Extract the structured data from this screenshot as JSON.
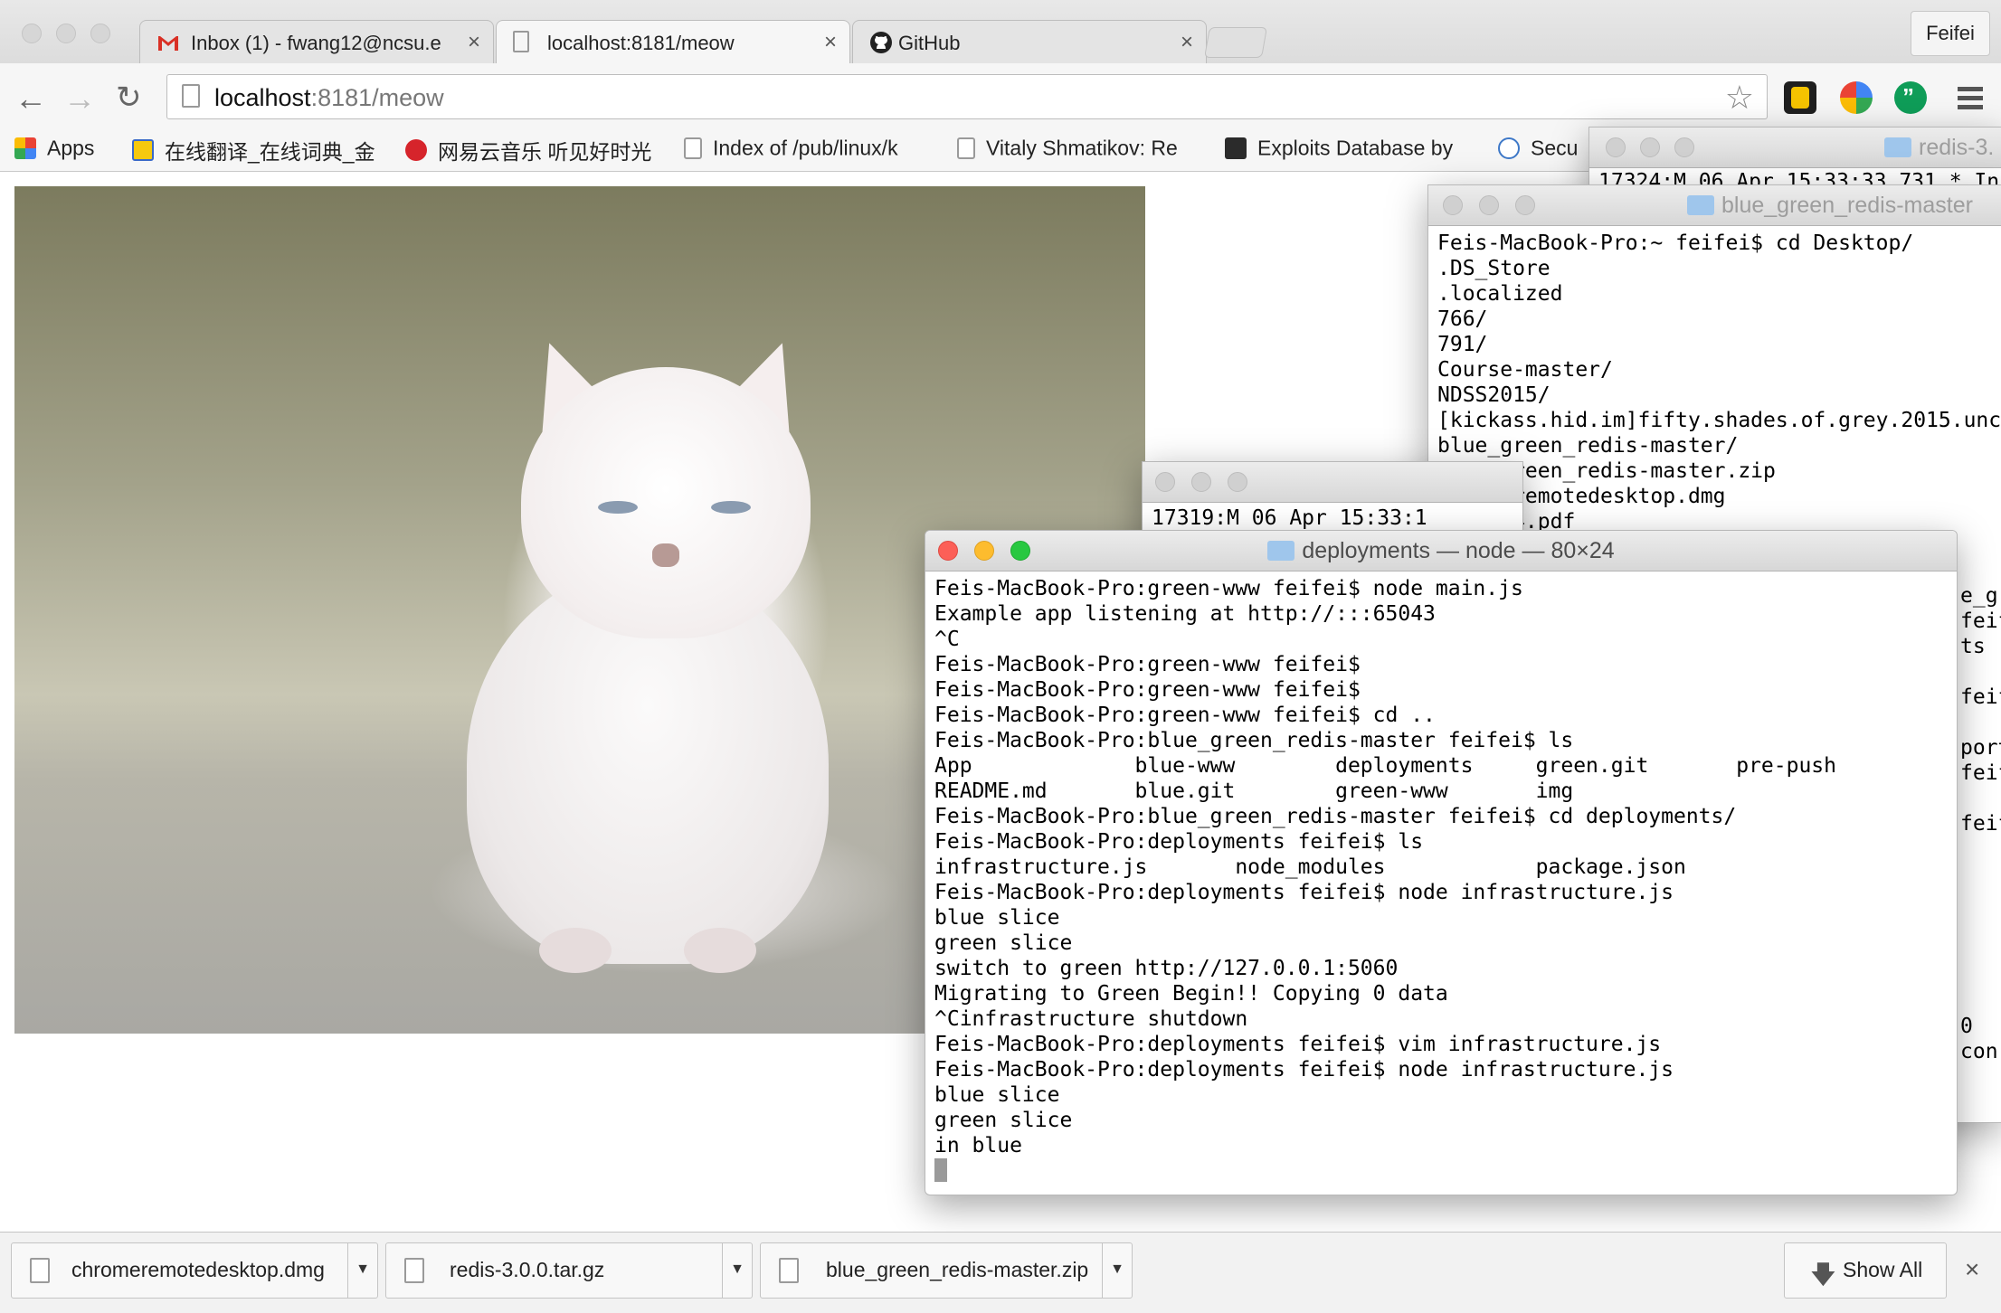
{
  "browser": {
    "tabs": [
      {
        "label": "Inbox (1) - fwang12@ncsu.e",
        "icon": "gmail-icon",
        "close": "×"
      },
      {
        "label": "localhost:8181/meow",
        "icon": "page-icon",
        "close": "×"
      },
      {
        "label": "GitHub",
        "icon": "github-icon",
        "close": "×"
      }
    ],
    "profile_name": "Feifei",
    "url_host": "localhost",
    "url_rest": ":8181/meow",
    "bookmarks": [
      {
        "label": "Apps",
        "icon": "apps-grid-icon"
      },
      {
        "label": "在线翻译_在线词典_金",
        "icon": "dictionary-icon"
      },
      {
        "label": "网易云音乐 听见好时光",
        "icon": "netease-music-icon"
      },
      {
        "label": "Index of /pub/linux/k",
        "icon": "page-icon"
      },
      {
        "label": "Vitaly Shmatikov: Re",
        "icon": "page-icon"
      },
      {
        "label": "Exploits Database by",
        "icon": "exploit-db-icon"
      },
      {
        "label": "Secu",
        "icon": "security-icon"
      }
    ],
    "accent": "#4285f4"
  },
  "terminals": {
    "back": {
      "title": "redis-3.",
      "line": "17324:M 06 Apr 15:33:33.731 * In"
    },
    "desktop": {
      "title": "blue_green_redis-master",
      "lines": [
        "Feis-MacBook-Pro:~ feifei$ cd Desktop/",
        ".DS_Store",
        ".localized",
        "766/",
        "791/",
        "Course-master/",
        "NDSS2015/",
        "[kickass.hid.im]fifty.shades.of.grey.2015.unc",
        "blue_green_redis-master/",
        "blue_green_redis-master.zip",
        "chromeremotedesktop.dmg",
        "micro14.pdf"
      ],
      "right_fragments": [
        "e_gr",
        "feif",
        "ts",
        "",
        "feif",
        "",
        "port",
        "feif",
        "",
        "feif",
        "",
        "",
        "",
        "",
        "",
        "",
        "",
        "0",
        "con"
      ]
    },
    "redis": {
      "line": "17319:M 06 Apr 15:33:1"
    },
    "main": {
      "title": "deployments — node — 80×24",
      "lines": [
        "Feis-MacBook-Pro:green-www feifei$ node main.js",
        "Example app listening at http://:::65043",
        "^C",
        "Feis-MacBook-Pro:green-www feifei$",
        "Feis-MacBook-Pro:green-www feifei$",
        "Feis-MacBook-Pro:green-www feifei$ cd ..",
        "Feis-MacBook-Pro:blue_green_redis-master feifei$ ls",
        "App             blue-www        deployments     green.git       pre-push",
        "README.md       blue.git        green-www       img",
        "Feis-MacBook-Pro:blue_green_redis-master feifei$ cd deployments/",
        "Feis-MacBook-Pro:deployments feifei$ ls",
        "infrastructure.js       node_modules            package.json",
        "Feis-MacBook-Pro:deployments feifei$ node infrastructure.js",
        "blue slice",
        "green slice",
        "switch to green http://127.0.0.1:5060",
        "Migrating to Green Begin!! Copying 0 data",
        "^Cinfrastructure shutdown",
        "Feis-MacBook-Pro:deployments feifei$ vim infrastructure.js",
        "Feis-MacBook-Pro:deployments feifei$ node infrastructure.js",
        "blue slice",
        "green slice",
        "in blue"
      ]
    }
  },
  "downloads": {
    "items": [
      {
        "name": "chromeremotedesktop.dmg"
      },
      {
        "name": "redis-3.0.0.tar.gz"
      },
      {
        "name": "blue_green_redis-master.zip"
      }
    ],
    "show_all": "Show All",
    "close": "×"
  }
}
